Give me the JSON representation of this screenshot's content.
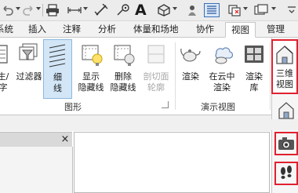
{
  "quick_access": {
    "icons": [
      "undo-icon",
      "redo-icon",
      "print-icon",
      "measure-icon",
      "dimension-icon",
      "tag-icon",
      "text-a-icon",
      "3d-box-icon",
      "thin-lines-icon",
      "switch-windows-icon",
      "customize-icon"
    ],
    "text_a": "A"
  },
  "tabs": [
    {
      "label": "系统"
    },
    {
      "label": "插入"
    },
    {
      "label": "注释"
    },
    {
      "label": "分析"
    },
    {
      "label": "体量和场地"
    },
    {
      "label": "协作"
    },
    {
      "label": "视图",
      "active": true
    },
    {
      "label": "管理"
    }
  ],
  "ribbon": {
    "buttons": [
      {
        "label": "生/\n字",
        "icon": "visibility-graphics-icon"
      },
      {
        "label": "过滤器",
        "icon": "filter-icon"
      },
      {
        "label": "细\n线",
        "icon": "thin-lines-icon",
        "selected": true
      },
      {
        "label": "显示\n隐藏线",
        "icon": "show-hidden-lines-icon"
      },
      {
        "label": "删除\n隐藏线",
        "icon": "remove-hidden-lines-icon"
      },
      {
        "label": "剖切面\n轮廓",
        "icon": "cut-profile-icon",
        "disabled": true
      },
      {
        "label": "渲染",
        "icon": "render-teapot-icon"
      },
      {
        "label": "在云中\n渲染",
        "icon": "cloud-render-icon"
      },
      {
        "label": "渲染\n库",
        "icon": "render-gallery-icon"
      },
      {
        "label": "三维\n视图",
        "icon": "3d-house-icon",
        "highlighted": true
      }
    ],
    "groups": [
      {
        "label": "图形"
      },
      {
        "label": "演示视图"
      }
    ]
  },
  "dropdown": {
    "items": [
      "default-3d-house-icon",
      "camera-icon",
      "walkthrough-footsteps-icon"
    ]
  },
  "panel": {
    "close_glyph": "×"
  },
  "colors": {
    "accent_selected": "#d2e6f7",
    "highlight_red": "#e0212f",
    "tab_bg": "#f2f2f2"
  }
}
